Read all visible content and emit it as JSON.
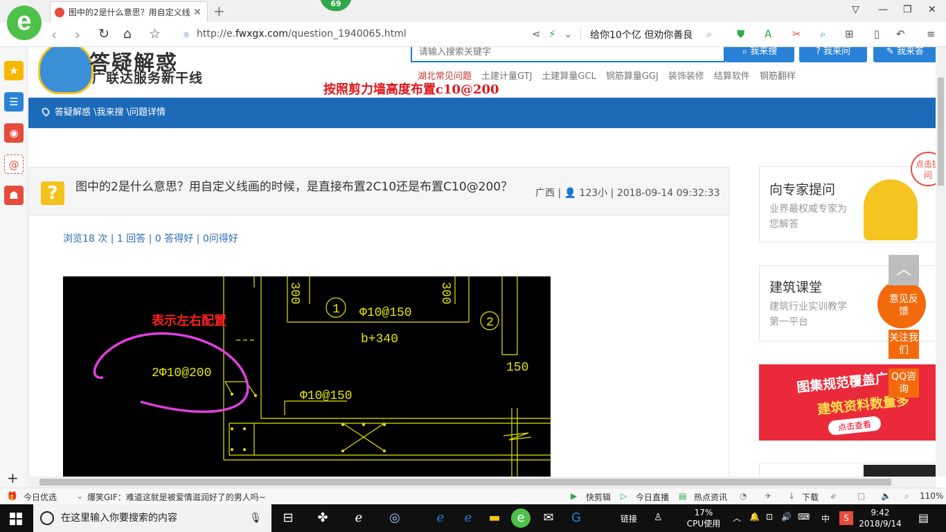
{
  "browser": {
    "tab_title": "图中的2是什么意思？用自定义线",
    "tab_close": "✕",
    "new_tab": "+",
    "badge": "69",
    "url_prefix": "http://e.",
    "url_domain": "fwxgx.com",
    "url_path": "/question_1940065.html",
    "search_hint": "给你10个亿 但劝你善良"
  },
  "site": {
    "title": "答疑解惑",
    "subtitle": "广联达服务新干线",
    "search_placeholder": "请输入搜索关键字",
    "btn_search": "我来搜",
    "btn_ask": "我来问",
    "btn_answer": "我来答",
    "hotlinks": [
      "湖北常见问题",
      "土建计量GTJ",
      "土建算量GCL",
      "钢筋算量GGJ",
      "装饰装修",
      "结算软件",
      "钢筋翻样"
    ],
    "breadcrumb": "答疑解惑 \\我来搜 \\问题详情"
  },
  "question": {
    "icon": "?",
    "title": "图中的2是什么意思？用自定义线画的时候，是直接布置2C10还是布置C10@200？",
    "meta": "广西 | 👤 123小 | 2018-09-14 09:32:33",
    "answer_overlay": "按照剪力墙高度布置c10@200",
    "stats": "浏览18 次 | 1 回答 | 0 答得好 | 0问得好"
  },
  "cad": {
    "note": "表示左右配置",
    "labels": [
      "2Φ10@200",
      "Φ10@150",
      "Φ10@150",
      "b+340",
      "150",
      "300",
      "300",
      "1",
      "2"
    ]
  },
  "right": {
    "card1_title": "向专家提问",
    "card1_sub": "业界最权威专家为您解答",
    "card1_tag": "点击提问",
    "card2_title": "建筑课堂",
    "card2_sub": "建筑行业实训教学第一平台",
    "banner_line1": "图集规范覆盖广",
    "banner_line2": "建筑资料数量多",
    "banner_btn": "点击查看",
    "float_feedback": "意见反馈",
    "float_follow": "关注我们",
    "float_qq": "QQ咨询"
  },
  "statusbar": {
    "left1": "今日优选",
    "news": "爆笑GIF：难道这就是被爱情滋润好了的男人吗~",
    "i1": "快剪辑",
    "i2": "今日直播",
    "i3": "热点资讯",
    "download": "下载",
    "zoom": "110%"
  },
  "taskbar": {
    "search_placeholder": "在这里输入你要搜索的内容",
    "links": "链接",
    "cpu_pct": "17%",
    "cpu_label": "CPU使用",
    "ime": "中",
    "time": "9:42",
    "date": "2018/9/14"
  }
}
